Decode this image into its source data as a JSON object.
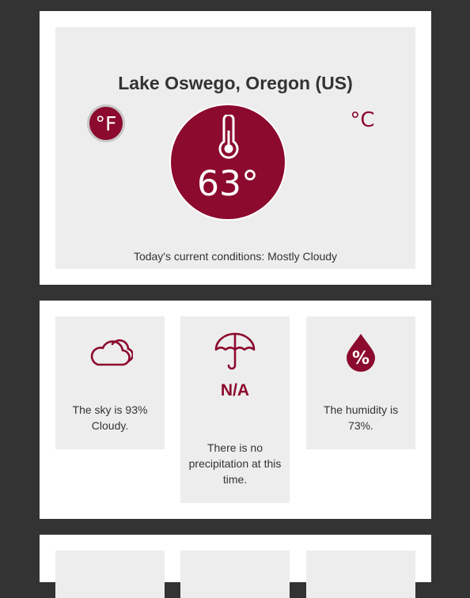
{
  "current": {
    "location": "Lake Oswego, Oregon (US)",
    "unit_f_label": "°F",
    "unit_c_label": "°C",
    "temperature": "63°",
    "conditions": "Today's current conditions: Mostly Cloudy",
    "icon": "thermometer-icon"
  },
  "details": {
    "sky": {
      "icon": "cloud-icon",
      "text": "The sky is 93% Cloudy."
    },
    "precipitation": {
      "icon": "umbrella-icon",
      "value": "N/A",
      "text": "There is no precipitation at this time."
    },
    "humidity": {
      "icon": "humidity-drop-icon",
      "text": "The humidity is 73%."
    }
  },
  "colors": {
    "accent": "#8c0a2e",
    "panel": "#ededed",
    "background": "#333333"
  }
}
